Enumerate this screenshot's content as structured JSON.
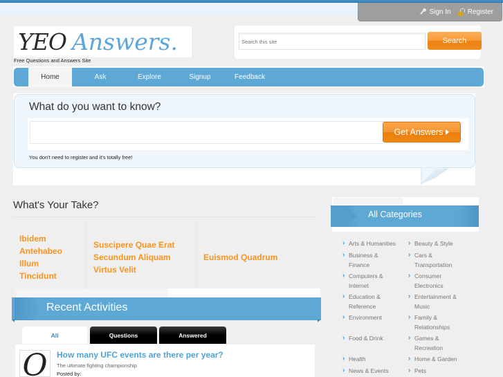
{
  "userbar": {
    "sign_in": "Sign In",
    "register": "Register"
  },
  "logo": {
    "part1": "YEO",
    "part2": "Answers."
  },
  "tagline": "Free Questions and Answers Site",
  "search": {
    "placeholder": "Search this site",
    "button": "Search"
  },
  "nav": {
    "items": [
      {
        "label": "Home",
        "active": true
      },
      {
        "label": "Ask"
      },
      {
        "label": "Explore"
      },
      {
        "label": "Signup"
      },
      {
        "label": "Feedback"
      }
    ]
  },
  "ask": {
    "title": "What do you want to know?",
    "value": "",
    "button": "Get Answers",
    "note": "You don't need to register and it's totally free!"
  },
  "take": {
    "title": "What's Your Take?",
    "columns": [
      [
        "Ibidem",
        "Antehabeo",
        "Illum",
        "Tincidunt"
      ],
      [
        "Suscipere Quae Erat",
        "Secundum Aliquam",
        "Virtus Velit"
      ],
      [
        "Euismod Quadrum"
      ]
    ]
  },
  "recent": {
    "title": "Recent Activities",
    "tabs": [
      "All",
      "Questions",
      "Answered"
    ],
    "items": [
      {
        "title": "How many UFC events are there per year?",
        "subtitle": "The ultimate fighting championship",
        "posted_by": "Posted by:",
        "avatar_letter": "O"
      }
    ]
  },
  "categories": {
    "title": "All Categories",
    "left": [
      "Arts & Humanities",
      "Business & Finance",
      "Computers & Internet",
      "Education & Reference",
      "Environment",
      "Food & Drink",
      "Health",
      "News & Events"
    ],
    "right": [
      "Beauty & Style",
      "Cars & Transportation",
      "Consumer Electronics",
      "Entertainment & Music",
      "Family & Relationships",
      "Games & Recreation",
      "Home & Garden",
      "Pets"
    ]
  },
  "colors": {
    "accent_blue": "#5ea8d6",
    "accent_orange": "#f7941e",
    "link_blue": "#4ea2d8"
  }
}
